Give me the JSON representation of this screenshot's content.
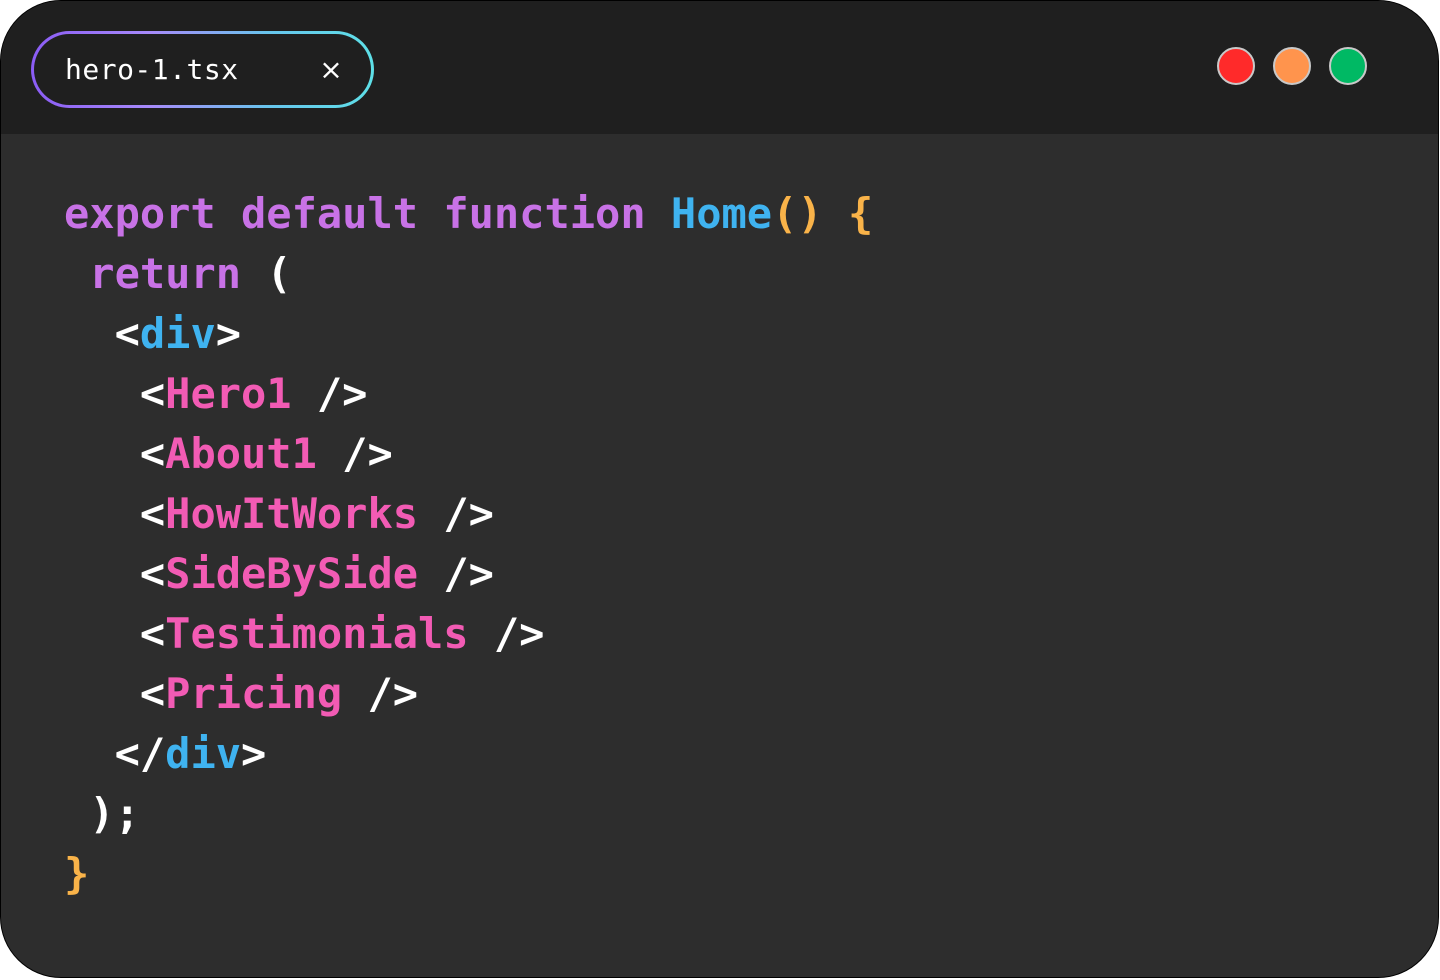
{
  "tab": {
    "label": "hero-1.tsx",
    "close_glyph": "×",
    "close_icon": "close-icon"
  },
  "window_controls": [
    {
      "name": "close",
      "color": "#ff2a2a"
    },
    {
      "name": "minimize",
      "color": "#ff944d"
    },
    {
      "name": "maximize",
      "color": "#00b964"
    }
  ],
  "colors": {
    "keyword": "#c872e6",
    "function_name": "#3fb3f0",
    "brace": "#f9b349",
    "html_tag": "#3fb3f0",
    "component": "#f25bb4",
    "plain": "#ffffff",
    "editor_bg": "#2d2d2d",
    "titlebar_bg": "#1f1f1f"
  },
  "code": {
    "line1": {
      "kw_export": "export",
      "kw_default": "default",
      "kw_function": "function",
      "fn_name": "Home",
      "parens": "()",
      "open_brace": "{"
    },
    "line2": {
      "kw_return": "return",
      "open_paren": "("
    },
    "line3": {
      "lt": "<",
      "tag": "div",
      "gt": ">"
    },
    "components": [
      {
        "lt": "<",
        "name": "Hero1",
        "close": " />"
      },
      {
        "lt": "<",
        "name": "About1",
        "close": " />"
      },
      {
        "lt": "<",
        "name": "HowItWorks",
        "close": " />"
      },
      {
        "lt": "<",
        "name": "SideBySide",
        "close": " />"
      },
      {
        "lt": "<",
        "name": "Testimonials",
        "close": " />"
      },
      {
        "lt": "<",
        "name": "Pricing",
        "close": " />"
      }
    ],
    "line10": {
      "lt_slash": "</",
      "tag": "div",
      "gt": ">"
    },
    "line11": {
      "close": ");"
    },
    "line12": {
      "close_brace": "}"
    }
  }
}
